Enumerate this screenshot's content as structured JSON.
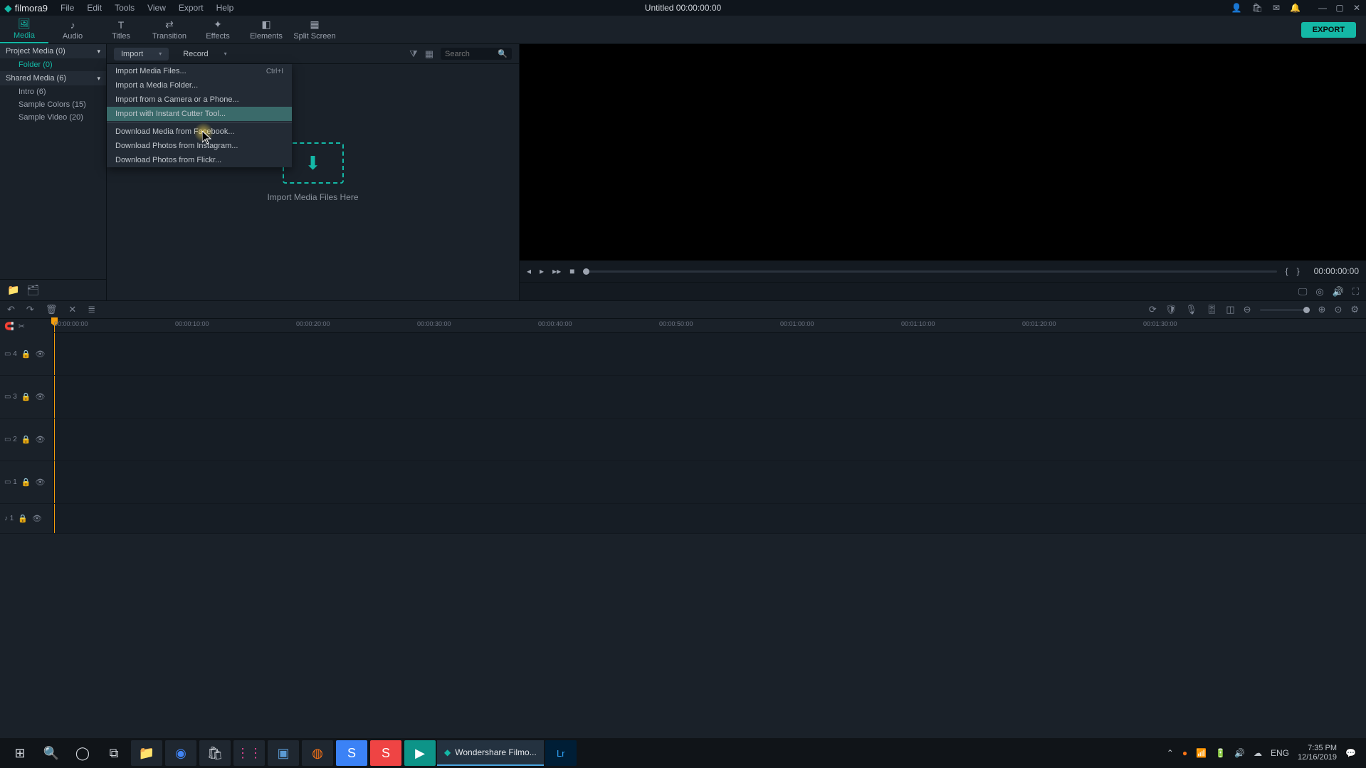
{
  "app": {
    "logo": "filmora9",
    "doc_title": "Untitled   00:00:00:00"
  },
  "menubar": [
    "File",
    "Edit",
    "Tools",
    "View",
    "Export",
    "Help"
  ],
  "tabs": [
    {
      "label": "Media",
      "icon": "🖼"
    },
    {
      "label": "Audio",
      "icon": "♪"
    },
    {
      "label": "Titles",
      "icon": "T"
    },
    {
      "label": "Transition",
      "icon": "⇄"
    },
    {
      "label": "Effects",
      "icon": "✦"
    },
    {
      "label": "Elements",
      "icon": "◧"
    },
    {
      "label": "Split Screen",
      "icon": "▦"
    }
  ],
  "export_label": "EXPORT",
  "sidebar": {
    "project": {
      "label": "Project Media (0)"
    },
    "folder": {
      "label": "Folder (0)"
    },
    "shared": {
      "label": "Shared Media (6)"
    },
    "items": [
      "Intro (6)",
      "Sample Colors (15)",
      "Sample Video (20)"
    ]
  },
  "media_toolbar": {
    "import": "Import",
    "record": "Record",
    "search_placeholder": "Search"
  },
  "import_menu": [
    {
      "label": "Import Media Files...",
      "shortcut": "Ctrl+I"
    },
    {
      "label": "Import a Media Folder..."
    },
    {
      "label": "Import from a Camera or a Phone..."
    },
    {
      "label": "Import with Instant Cutter Tool...",
      "hl": true
    },
    {
      "sep": true
    },
    {
      "label": "Download Media from Facebook..."
    },
    {
      "label": "Download Photos from Instagram..."
    },
    {
      "label": "Download Photos from Flickr..."
    }
  ],
  "dropzone": {
    "label": "Import Media Files Here"
  },
  "preview": {
    "timecode": "00:00:00:00"
  },
  "ruler": [
    "00:00:00:00",
    "00:00:10:00",
    "00:00:20:00",
    "00:00:30:00",
    "00:00:40:00",
    "00:00:50:00",
    "00:01:00:00",
    "00:01:10:00",
    "00:01:20:00",
    "00:01:30:00"
  ],
  "tracks": {
    "video": [
      "4",
      "3",
      "2",
      "1"
    ],
    "audio": [
      "1"
    ]
  },
  "taskbar": {
    "app_label": "Wondershare Filmo...",
    "lang": "ENG",
    "time": "7:35 PM",
    "date": "12/16/2019"
  }
}
